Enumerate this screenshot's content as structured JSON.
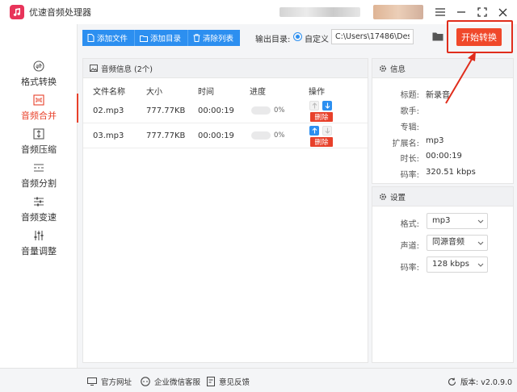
{
  "app": {
    "title": "优速音频处理器",
    "logo_text": "♫"
  },
  "window_controls": {
    "menu": "☰",
    "minimize": "—",
    "maximize": "⛶",
    "close": "✕"
  },
  "sidebar": {
    "items": [
      {
        "label": "格式转换",
        "icon": "format-convert-icon",
        "active": false
      },
      {
        "label": "音频合并",
        "icon": "audio-merge-icon",
        "active": true
      },
      {
        "label": "音频压缩",
        "icon": "audio-compress-icon",
        "active": false
      },
      {
        "label": "音频分割",
        "icon": "audio-split-icon",
        "active": false
      },
      {
        "label": "音频变速",
        "icon": "audio-speed-icon",
        "active": false
      },
      {
        "label": "音量调整",
        "icon": "volume-adjust-icon",
        "active": false
      }
    ]
  },
  "toolbar": {
    "add_file": "添加文件",
    "add_dir": "添加目录",
    "clear_list": "清除列表",
    "output_label": "输出目录:",
    "radio_label": "自定义",
    "output_path": "C:\\Users\\17486\\Deskto",
    "start": "开始转换"
  },
  "file_panel": {
    "title": "音频信息 (2个)",
    "columns": [
      "文件名称",
      "大小",
      "时间",
      "进度",
      "操作"
    ],
    "rows": [
      {
        "name": "02.mp3",
        "size": "777.77KB",
        "time": "00:00:19",
        "progress": 0,
        "progress_text": "0%",
        "up_enabled": false,
        "down_enabled": true,
        "delete": "删除"
      },
      {
        "name": "03.mp3",
        "size": "777.77KB",
        "time": "00:00:19",
        "progress": 0,
        "progress_text": "0%",
        "up_enabled": true,
        "down_enabled": false,
        "delete": "删除"
      }
    ]
  },
  "info_panel": {
    "title": "信息",
    "fields": [
      {
        "key": "标题:",
        "value": "新录音"
      },
      {
        "key": "歌手:",
        "value": ""
      },
      {
        "key": "专辑:",
        "value": ""
      },
      {
        "key": "扩展名:",
        "value": "mp3"
      },
      {
        "key": "时长:",
        "value": "00:00:19"
      },
      {
        "key": "码率:",
        "value": "320.51 kbps"
      }
    ]
  },
  "settings_panel": {
    "title": "设置",
    "fields": [
      {
        "key": "格式:",
        "value": "mp3"
      },
      {
        "key": "声道:",
        "value": "同源音频"
      },
      {
        "key": "码率:",
        "value": "128 kbps"
      }
    ]
  },
  "footer": {
    "website": "官方网址",
    "wechat": "企业微信客服",
    "feedback": "意见反馈",
    "version": "版本: v2.0.9.0"
  },
  "colors": {
    "accent": "#2c8ff0",
    "primary_action": "#f0482a",
    "highlight": "#e02d1c"
  }
}
